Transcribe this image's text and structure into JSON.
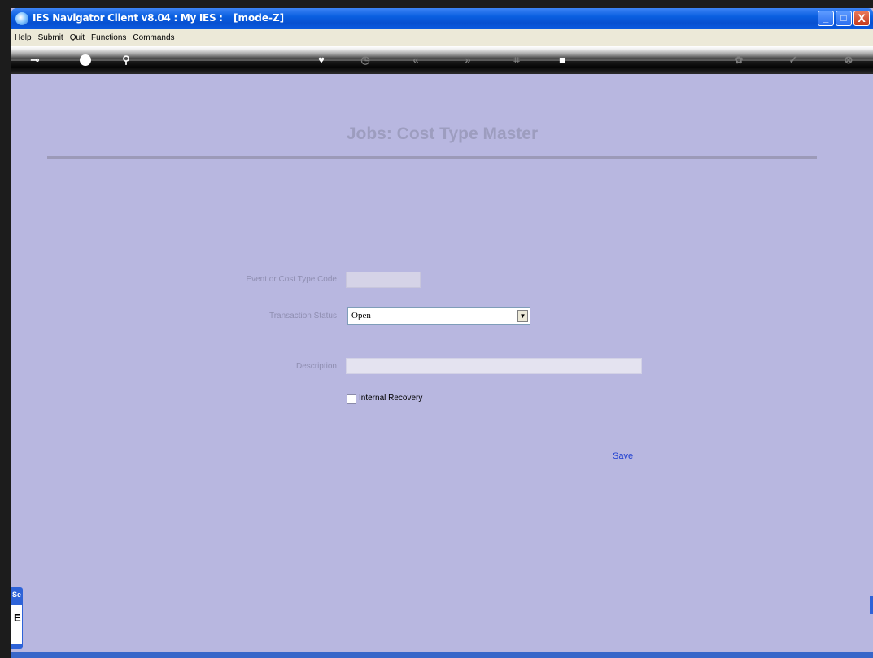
{
  "window": {
    "title": "IES Navigator Client v8.04 : My IES :",
    "mode": "[mode-Z]",
    "buttons": {
      "minimize": "_",
      "maximize": "□",
      "close": "X"
    }
  },
  "menu": {
    "items": [
      "Help",
      "Submit",
      "Quit",
      "Functions",
      "Commands"
    ]
  },
  "toolbar": {
    "icons": [
      "key-icon",
      "help-icon",
      "search-icon",
      "heart-icon",
      "clock-icon",
      "previous-icon",
      "next-icon",
      "bookmark-icon",
      "stop-icon",
      "refresh-icon",
      "confirm-icon",
      "close-icon"
    ]
  },
  "form": {
    "title": "Jobs: Cost Type Master",
    "code_label": "Event or Cost Type Code",
    "code_value": "",
    "status_label": "Transaction Status",
    "status_value": "Open",
    "description_label": "Description",
    "description_value": "",
    "internal_recovery_label": "Internal Recovery",
    "internal_recovery_checked": false,
    "save_label": "Save"
  },
  "side_panel": {
    "tab_label": "Se",
    "content": "E"
  },
  "colors": {
    "background": "#b8b7e0",
    "title_text": "#9d9dbf",
    "link": "#1f3fd0",
    "titlebar": "#0a5fe0"
  }
}
